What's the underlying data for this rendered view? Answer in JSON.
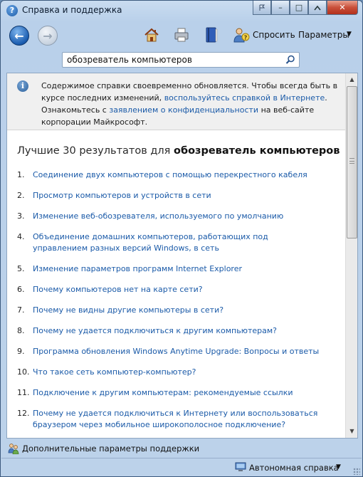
{
  "window": {
    "title": "Справка и поддержка",
    "controls": {
      "minimize": "–",
      "maximize": "□",
      "close": "✕"
    }
  },
  "toolbar": {
    "back_label": "←",
    "forward_label": "→",
    "ask_label": "Спросить",
    "options_label": "Параметры",
    "options_arrow": "▼",
    "icons": [
      "home-icon",
      "print-icon",
      "book-icon",
      "ask-icon"
    ]
  },
  "search": {
    "value": "обозреватель компьютеров"
  },
  "notice": {
    "text_1": "Содержимое справки своевременно обновляется. Чтобы всегда быть в курсе последних изменений, ",
    "link_1": "воспользуйтесь справкой в Интернете",
    "text_2": ". Ознакомьтесь с ",
    "link_2": "заявлением о конфиденциальности",
    "text_3": " на веб-сайте корпорации Майкрософт."
  },
  "results": {
    "title_prefix": "Лучшие 30 результатов для ",
    "title_query": "обозреватель компьютеров",
    "items": [
      {
        "num": "1.",
        "label": "Соединение двух компьютеров с помощью перекрестного кабеля"
      },
      {
        "num": "2.",
        "label": "Просмотр компьютеров и устройств в сети"
      },
      {
        "num": "3.",
        "label": "Изменение веб-обозревателя, используемого по умолчанию"
      },
      {
        "num": "4.",
        "label": "Объединение домашних компьютеров, работающих под управлением разных версий Windows, в сеть"
      },
      {
        "num": "5.",
        "label": "Изменение параметров программ Internet Explorer"
      },
      {
        "num": "6.",
        "label": "Почему компьютеров нет на карте сети?"
      },
      {
        "num": "7.",
        "label": "Почему не видны другие компьютеры в сети?"
      },
      {
        "num": "8.",
        "label": "Почему не удается подключиться к другим компьютерам?"
      },
      {
        "num": "9.",
        "label": "Программа обновления Windows Anytime Upgrade: Вопросы и ответы"
      },
      {
        "num": "10.",
        "label": "Что такое сеть компьютер-компьютер?"
      },
      {
        "num": "11.",
        "label": "Подключение к другим компьютерам: рекомендуемые ссылки"
      },
      {
        "num": "12.",
        "label": "Почему не удается подключиться к Интернету или воспользоваться браузером через мобильное широкополосное подключение?"
      }
    ]
  },
  "scrollbar": {
    "up": "▲",
    "down": "▼"
  },
  "support": {
    "label": "Дополнительные параметры поддержки"
  },
  "status": {
    "label": "Автономная справка",
    "arrow": "▼"
  }
}
